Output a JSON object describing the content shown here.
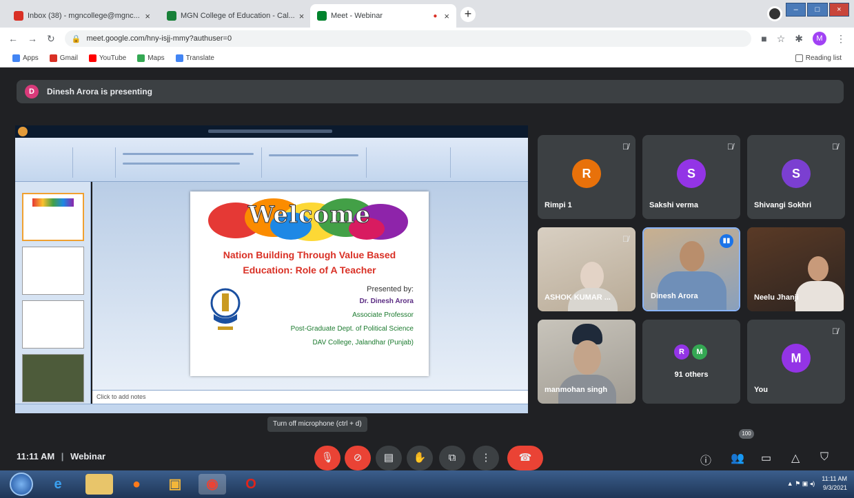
{
  "browser": {
    "tabs": [
      {
        "label": "Inbox (38) - mgncollege@mgnc...",
        "icon": "gmail-icon",
        "color": "#d93025",
        "active": false
      },
      {
        "label": "MGN College of Education - Cal...",
        "icon": "classroom-icon",
        "color": "#188038",
        "active": false
      },
      {
        "label": "Meet - Webinar",
        "icon": "meet-icon",
        "color": "#00832d",
        "active": true
      }
    ],
    "url": "meet.google.com/hny-isjj-mmy?authuser=0",
    "profile_initial": "M",
    "bookmarks": [
      {
        "label": "Apps",
        "color": "#4285f4"
      },
      {
        "label": "Gmail",
        "color": "#d93025"
      },
      {
        "label": "YouTube",
        "color": "#ff0000"
      },
      {
        "label": "Maps",
        "color": "#34a853"
      },
      {
        "label": "Translate",
        "color": "#4285f4"
      }
    ],
    "reading_list": "Reading list"
  },
  "meet": {
    "presenting_text": "Dinesh Arora is presenting",
    "presenter_initial": "D",
    "time": "11:11 AM",
    "separator": "|",
    "meeting_name": "Webinar",
    "tooltip": "Turn off microphone (ctrl + d)",
    "participant_count_badge": "100",
    "participants": [
      {
        "name": "Rimpi 1",
        "initial": "R",
        "color": "#e8710a",
        "video": false
      },
      {
        "name": "Sakshi verma",
        "initial": "S",
        "color": "#9334e6",
        "video": false
      },
      {
        "name": "Shivangi Sokhri",
        "initial": "S",
        "color": "#7b3fd1",
        "video": false
      },
      {
        "name": "ASHOK KUMAR ...",
        "initial": "",
        "color": "#c9b9a3",
        "video": true
      },
      {
        "name": "Dinesh Arora",
        "initial": "",
        "color": "#8a9bb3",
        "video": true
      },
      {
        "name": "Neelu Jhanji",
        "initial": "",
        "color": "#6b4e3a",
        "video": true
      },
      {
        "name": "manmohan singh",
        "initial": "",
        "color": "#a9a39a",
        "video": true
      },
      {
        "name": "91 others",
        "initial": "",
        "color": "#3c4043",
        "video": false
      },
      {
        "name": "You",
        "initial": "M",
        "color": "#9334e6",
        "video": false
      }
    ],
    "others_initials": [
      "R",
      "M"
    ]
  },
  "slide": {
    "welcome": "Welcome",
    "title_line1": "Nation Building Through Value Based",
    "title_line2": "Education: Role of A Teacher",
    "presented_by": "Presented by:",
    "presenter": "Dr. Dinesh Arora",
    "designation": "Associate Professor",
    "dept": "Post-Graduate Dept. of Political Science",
    "college": "DAV College, Jalandhar (Punjab)",
    "notes_placeholder": "Click to add notes"
  },
  "taskbar": {
    "time": "11:11 AM",
    "date": "9/3/2021"
  }
}
